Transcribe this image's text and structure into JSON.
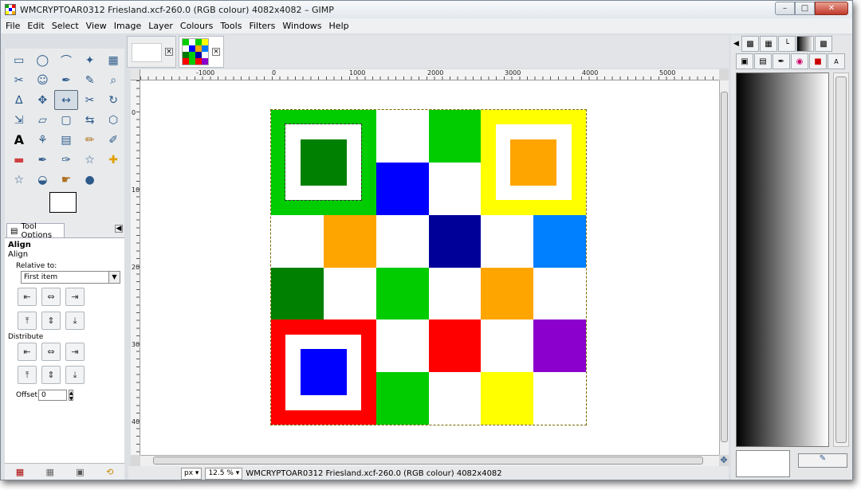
{
  "window": {
    "title": "WMCRYPTOAR0312 Friesland.xcf-260.0 (RGB colour) 4082x4082 – GIMP",
    "minimize": "–",
    "maximize": "□",
    "close": "✕"
  },
  "menu": [
    {
      "label": "File"
    },
    {
      "label": "Edit"
    },
    {
      "label": "Select"
    },
    {
      "label": "View"
    },
    {
      "label": "Image"
    },
    {
      "label": "Layer"
    },
    {
      "label": "Colours"
    },
    {
      "label": "Tools"
    },
    {
      "label": "Filters"
    },
    {
      "label": "Windows"
    },
    {
      "label": "Help"
    }
  ],
  "tools": [
    "rect-select-icon",
    "ellipse-select-icon",
    "free-select-icon",
    "fuzzy-select-icon",
    "by-colour-select-icon",
    "scissors-icon",
    "foreground-select-icon",
    "paths-icon",
    "colour-picker-icon",
    "zoom-icon",
    "measure-icon",
    "move-icon",
    "align-icon",
    "crop-icon",
    "rotate-icon",
    "scale-icon",
    "shear-icon",
    "perspective-icon",
    "flip-icon",
    "cage-icon",
    "text-icon",
    "bucket-fill-icon",
    "blend-icon",
    "pencil-icon",
    "paintbrush-icon",
    "eraser-icon",
    "airbrush-icon",
    "ink-icon",
    "clone-icon",
    "heal-icon",
    "perspective-clone-icon",
    "blur-icon",
    "smudge-icon",
    "dodge-burn-icon"
  ],
  "tool_options": {
    "tab_label": "Tool Options",
    "title": "Align",
    "subtitle": "Align",
    "relative_to_label": "Relative to:",
    "relative_to_value": "First item",
    "distribute_label": "Distribute",
    "offset_label": "Offset:",
    "offset_value": "0"
  },
  "rulers": {
    "h": [
      "-1000",
      "0",
      "1000",
      "2000",
      "3000",
      "4000",
      "5000"
    ],
    "v": [
      "0",
      "1000",
      "2000",
      "3000",
      "4000"
    ]
  },
  "status": {
    "unit": "px",
    "zoom": "12.5 %",
    "message": "WMCRYPTOAR0312 Friesland.xcf-260.0 (RGB colour) 4082x4082"
  },
  "colors": {
    "green": "#00cc00",
    "darkgreen": "#008000",
    "blue": "#0000ff",
    "navy": "#000099",
    "yellow": "#ffff00",
    "orange": "#ffa500",
    "red": "#ff0000",
    "purple": "#8b00cc",
    "azure": "#007fff"
  }
}
